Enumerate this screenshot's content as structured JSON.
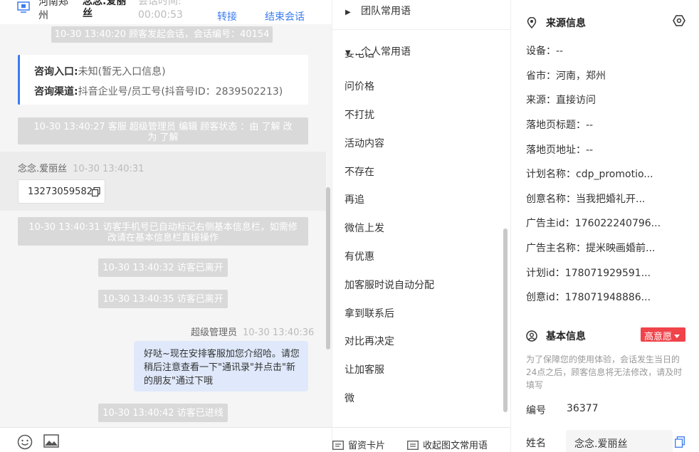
{
  "header": {
    "location": "河南郑州",
    "visitor_name": "念念.爱丽丝",
    "duration_label": "会话时间:",
    "duration": "00:00:53",
    "transfer_label": "转接",
    "end_label": "结束会话"
  },
  "chat": {
    "sys1": "10-30 13:40:20 顾客发起会话，会话编号：40154",
    "entry_label": "咨询入口:",
    "entry_value": "未知(暂无入口信息)",
    "channel_label": "咨询渠道:",
    "channel_value": "抖音企业号/员工号(抖音号ID：2839502213)",
    "sys2": "10-30 13:40:27 客服 超级管理员 编辑 顾客状态 ：由 了解 改为 了解",
    "visitor_sender": "念念.爱丽丝",
    "visitor_time": "10-30 13:40:31",
    "phone": "13273059582",
    "sys3": "10-30 13:40:31 访客手机号已自动标记右侧基本信息栏，如需修改请在基本信息栏直接操作",
    "sys4": "10-30 13:40:32 访客已离开",
    "sys5": "10-30 13:40:35 访客已离开",
    "agent_sender": "超级管理员",
    "agent_time": "10-30 13:40:36",
    "agent_message": "好哒~现在安排客服加您介绍哈。请您稍后注意查看一下\"通讯录\"并点击\"新的朋友\"通过下哦",
    "sys6": "10-30 13:40:42 访客已进线"
  },
  "phrases": {
    "team_group": "团队常用语",
    "personal_group": "个人常用语",
    "items": [
      "要电话",
      "问价格",
      "不打扰",
      "活动内容",
      "不存在",
      "再追",
      "微信上发",
      "有优惠",
      "加客服时说自动分配",
      "拿到联系后",
      "对比再决定",
      "让加客服",
      "微"
    ],
    "footer_card": "留资卡片",
    "footer_collapse": "收起图文常用语"
  },
  "info": {
    "source_title": "来源信息",
    "device": "设备：--",
    "province": "省市：河南，郑州",
    "origin": "来源：直接访问",
    "landing_title": "落地页标题：--",
    "landing_url": "落地页地址：--",
    "plan_name": "计划名称：cdp_promotio...",
    "creative_name": "创意名称：当我把婚礼开...",
    "advertiser_id": "广告主id：176022240796...",
    "advertiser_name": "广告主名称：提米映画婚前...",
    "plan_id": "计划id：178071929591...",
    "creative_id": "创意id：178071948886...",
    "basic_title": "基本信息",
    "intent_badge": "高意愿",
    "note": "为了保障您的使用体验，会话发生当日的24点之后，顾客信息将无法修改，请及时填写",
    "number_label": "编号",
    "number_value": "36377",
    "name_label": "姓名",
    "name_value": "念念.爱丽丝"
  },
  "colors": {
    "accent": "#3a7bf0",
    "badge": "#f0434a"
  }
}
